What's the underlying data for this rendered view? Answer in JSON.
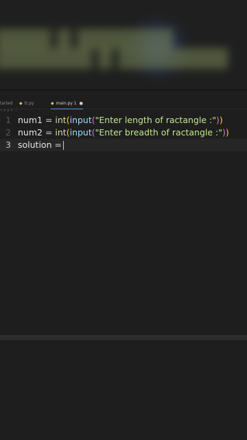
{
  "tabs": [
    {
      "label": "tarted"
    },
    {
      "label": "tt.py"
    },
    {
      "label": "main.py 1",
      "modified_dot": "●"
    }
  ],
  "breadcrumb": "• > y > ...",
  "editor": {
    "lines": [
      {
        "number": "1",
        "var": "num1",
        "op": " = ",
        "fn_int": "int",
        "p1": "(",
        "fn_input": "input",
        "p2": "(",
        "str": "\"Enter length of ractangle :\"",
        "p3": ")",
        "p4": ")"
      },
      {
        "number": "2",
        "var": "num2",
        "op": " = ",
        "fn_int": "int",
        "p1": "(",
        "fn_input": "input",
        "p2": "(",
        "str": "\"Enter breadth of ractangle :\"",
        "p3": ")",
        "p4": ")"
      },
      {
        "number": "3",
        "var": "solution",
        "op": " ="
      }
    ]
  },
  "colors": {
    "background": "#1e1e1e",
    "function": "#dcdcaa",
    "string": "#c3e88d",
    "paren": "#ffd700"
  }
}
